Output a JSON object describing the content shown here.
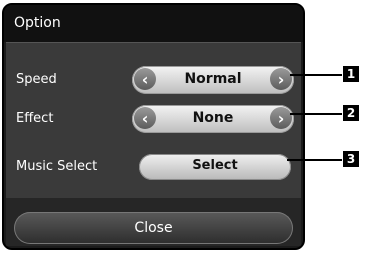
{
  "dialog": {
    "title": "Option",
    "rows": [
      {
        "label": "Speed",
        "value": "Normal",
        "left_arrow": "‹",
        "right_arrow": "›"
      },
      {
        "label": "Effect",
        "value": "None",
        "left_arrow": "‹",
        "right_arrow": "›"
      },
      {
        "label": "Music Select",
        "button": "Select"
      }
    ],
    "close_label": "Close"
  },
  "callouts": [
    "1",
    "2",
    "3"
  ]
}
